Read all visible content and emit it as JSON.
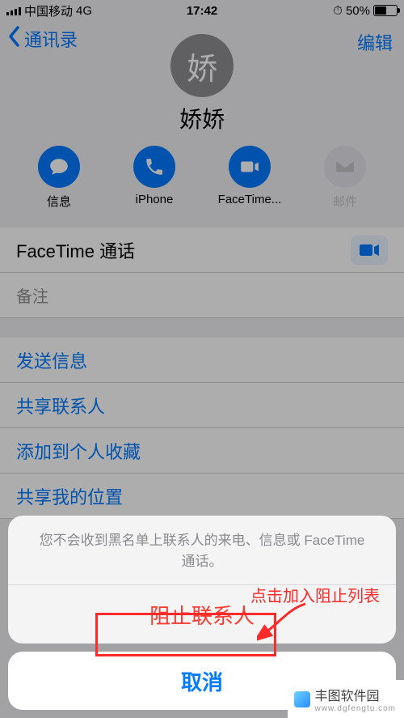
{
  "status_bar": {
    "carrier": "中国移动",
    "network": "4G",
    "time": "17:42",
    "battery_pct": "50%"
  },
  "nav": {
    "back": "通讯录",
    "edit": "编辑"
  },
  "contact": {
    "avatar_initial": "娇",
    "name": "娇娇"
  },
  "actions": {
    "message": "信息",
    "phone": "iPhone",
    "facetime": "FaceTime...",
    "mail": "邮件"
  },
  "cells": {
    "facetime_call": "FaceTime 通话",
    "notes": "备注",
    "send_message": "发送信息",
    "share_contact": "共享联系人",
    "add_favorite": "添加到个人收藏",
    "share_location": "共享我的位置"
  },
  "action_sheet": {
    "message": "您不会收到黑名单上联系人的来电、信息或 FaceTime 通话。",
    "block": "阻止联系人",
    "cancel": "取消"
  },
  "annotation": {
    "label": "点击加入阻止列表"
  },
  "watermark": {
    "title": "丰图软件园",
    "url": "www.dgfengtu.com"
  },
  "colors": {
    "ios_blue": "#007aff",
    "ios_red": "#ff3b30",
    "annotation_red": "#ff2a2a"
  },
  "icons": {
    "message": "speech-bubble-icon",
    "phone": "phone-icon",
    "facetime": "video-camera-icon",
    "mail": "envelope-icon",
    "back": "chevron-left-icon"
  }
}
